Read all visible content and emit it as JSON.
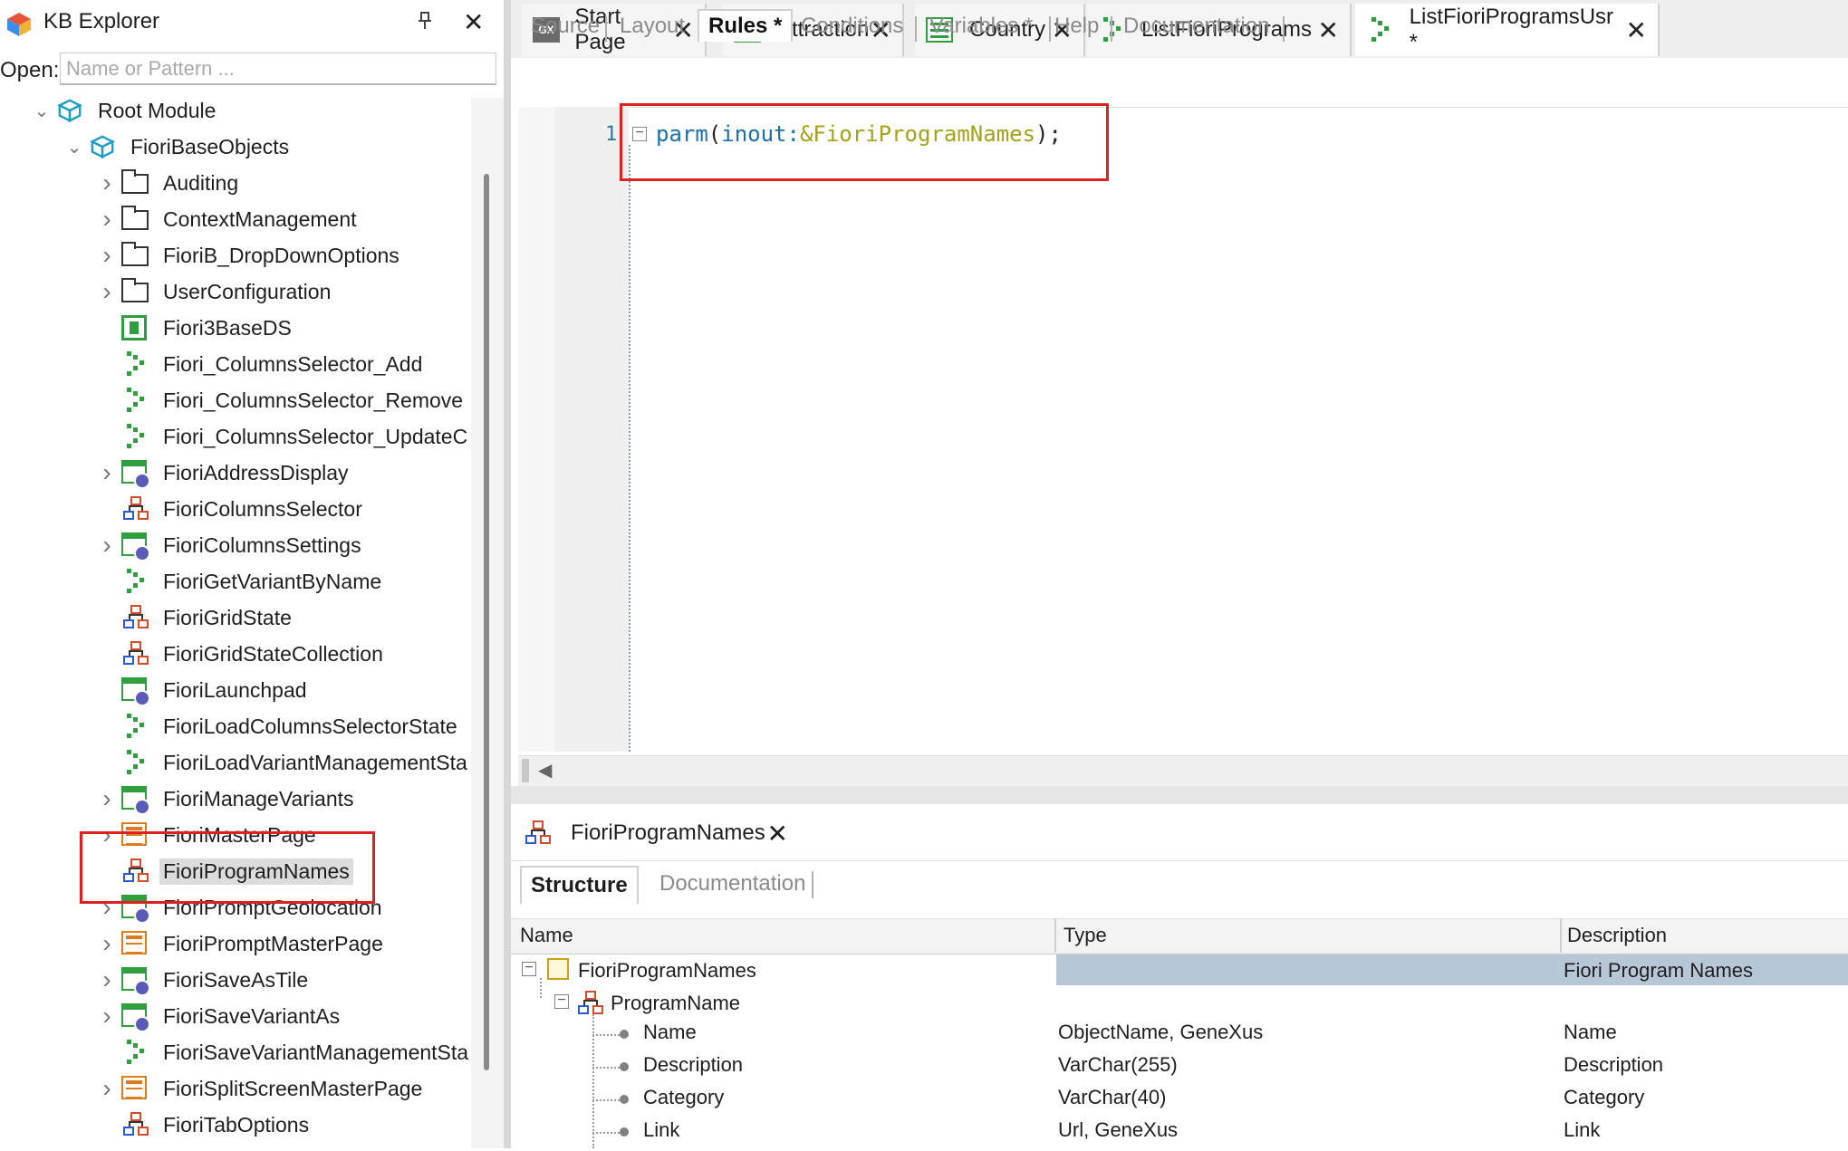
{
  "kb_explorer": {
    "title": "KB Explorer",
    "open_label": "Open:",
    "open_placeholder": "Name or Pattern ...",
    "tree": [
      {
        "label": "Root Module",
        "icon": "module-icon"
      },
      {
        "label": "FioriBaseObjects",
        "icon": "module-icon"
      },
      {
        "label": "Auditing",
        "icon": "folder-icon"
      },
      {
        "label": "ContextManagement",
        "icon": "folder-icon"
      },
      {
        "label": "FioriB_DropDownOptions",
        "icon": "folder-icon"
      },
      {
        "label": "UserConfiguration",
        "icon": "folder-icon"
      },
      {
        "label": "Fiori3BaseDS",
        "icon": "design-system-icon"
      },
      {
        "label": "Fiori_ColumnsSelector_Add",
        "icon": "procedure-icon"
      },
      {
        "label": "Fiori_ColumnsSelector_Remove",
        "icon": "procedure-icon"
      },
      {
        "label": "Fiori_ColumnsSelector_UpdateC",
        "icon": "procedure-icon"
      },
      {
        "label": "FioriAddressDisplay",
        "icon": "webpanel-icon"
      },
      {
        "label": "FioriColumnsSelector",
        "icon": "sdt-icon"
      },
      {
        "label": "FioriColumnsSettings",
        "icon": "webpanel-icon"
      },
      {
        "label": "FioriGetVariantByName",
        "icon": "procedure-icon"
      },
      {
        "label": "FioriGridState",
        "icon": "sdt-icon"
      },
      {
        "label": "FioriGridStateCollection",
        "icon": "sdt-icon"
      },
      {
        "label": "FioriLaunchpad",
        "icon": "webpanel-icon"
      },
      {
        "label": "FioriLoadColumnsSelectorState",
        "icon": "procedure-icon"
      },
      {
        "label": "FioriLoadVariantManagementSta",
        "icon": "procedure-icon"
      },
      {
        "label": "FioriManageVariants",
        "icon": "webpanel-icon"
      },
      {
        "label": "FioriMasterPage",
        "icon": "masterpage-icon"
      },
      {
        "label": "FioriProgramNames",
        "icon": "sdt-icon"
      },
      {
        "label": "FioriPromptGeolocation",
        "icon": "webpanel-icon"
      },
      {
        "label": "FioriPromptMasterPage",
        "icon": "masterpage-icon"
      },
      {
        "label": "FioriSaveAsTile",
        "icon": "webpanel-icon"
      },
      {
        "label": "FioriSaveVariantAs",
        "icon": "webpanel-icon"
      },
      {
        "label": "FioriSaveVariantManagementSta",
        "icon": "procedure-icon"
      },
      {
        "label": "FioriSplitScreenMasterPage",
        "icon": "masterpage-icon"
      },
      {
        "label": "FioriTabOptions",
        "icon": "sdt-icon"
      }
    ]
  },
  "tabs": [
    {
      "label": "Start Page",
      "icon": "gx-icon"
    },
    {
      "label": "Attraction",
      "icon": "transaction-icon"
    },
    {
      "label": "Country",
      "icon": "transaction-icon"
    },
    {
      "label": "ListFioriPrograms",
      "icon": "procedure-icon"
    },
    {
      "label": "ListFioriProgramsUsr *",
      "icon": "procedure-icon"
    }
  ],
  "subtabs": [
    "Source",
    "Layout",
    "Rules *",
    "Conditions",
    "Variables *",
    "Help",
    "Documentation"
  ],
  "editor": {
    "line_number": "1",
    "code": {
      "fn": "parm",
      "open": "(",
      "mode": "inout:",
      "var": "&FioriProgramNames",
      "close": ");"
    }
  },
  "bottom_panel": {
    "tab_label": "FioriProgramNames",
    "subtabs": [
      "Structure",
      "Documentation"
    ],
    "columns": [
      "Name",
      "Type",
      "Description"
    ],
    "rows": [
      {
        "name": "FioriProgramNames",
        "type": "",
        "description": "Fiori Program Names"
      },
      {
        "name": "ProgramName",
        "type": "",
        "description": ""
      },
      {
        "name": "Name",
        "type": "ObjectName, GeneXus",
        "description": "Name"
      },
      {
        "name": "Description",
        "type": "VarChar(255)",
        "description": "Description"
      },
      {
        "name": "Category",
        "type": "VarChar(40)",
        "description": "Category"
      },
      {
        "name": "Link",
        "type": "Url, GeneXus",
        "description": "Link"
      }
    ]
  },
  "colors": {
    "highlight_border": "#e02020",
    "selected_row": "#b7c7d8",
    "keyword": "#1a6fb0",
    "variable": "#a3a31a"
  }
}
